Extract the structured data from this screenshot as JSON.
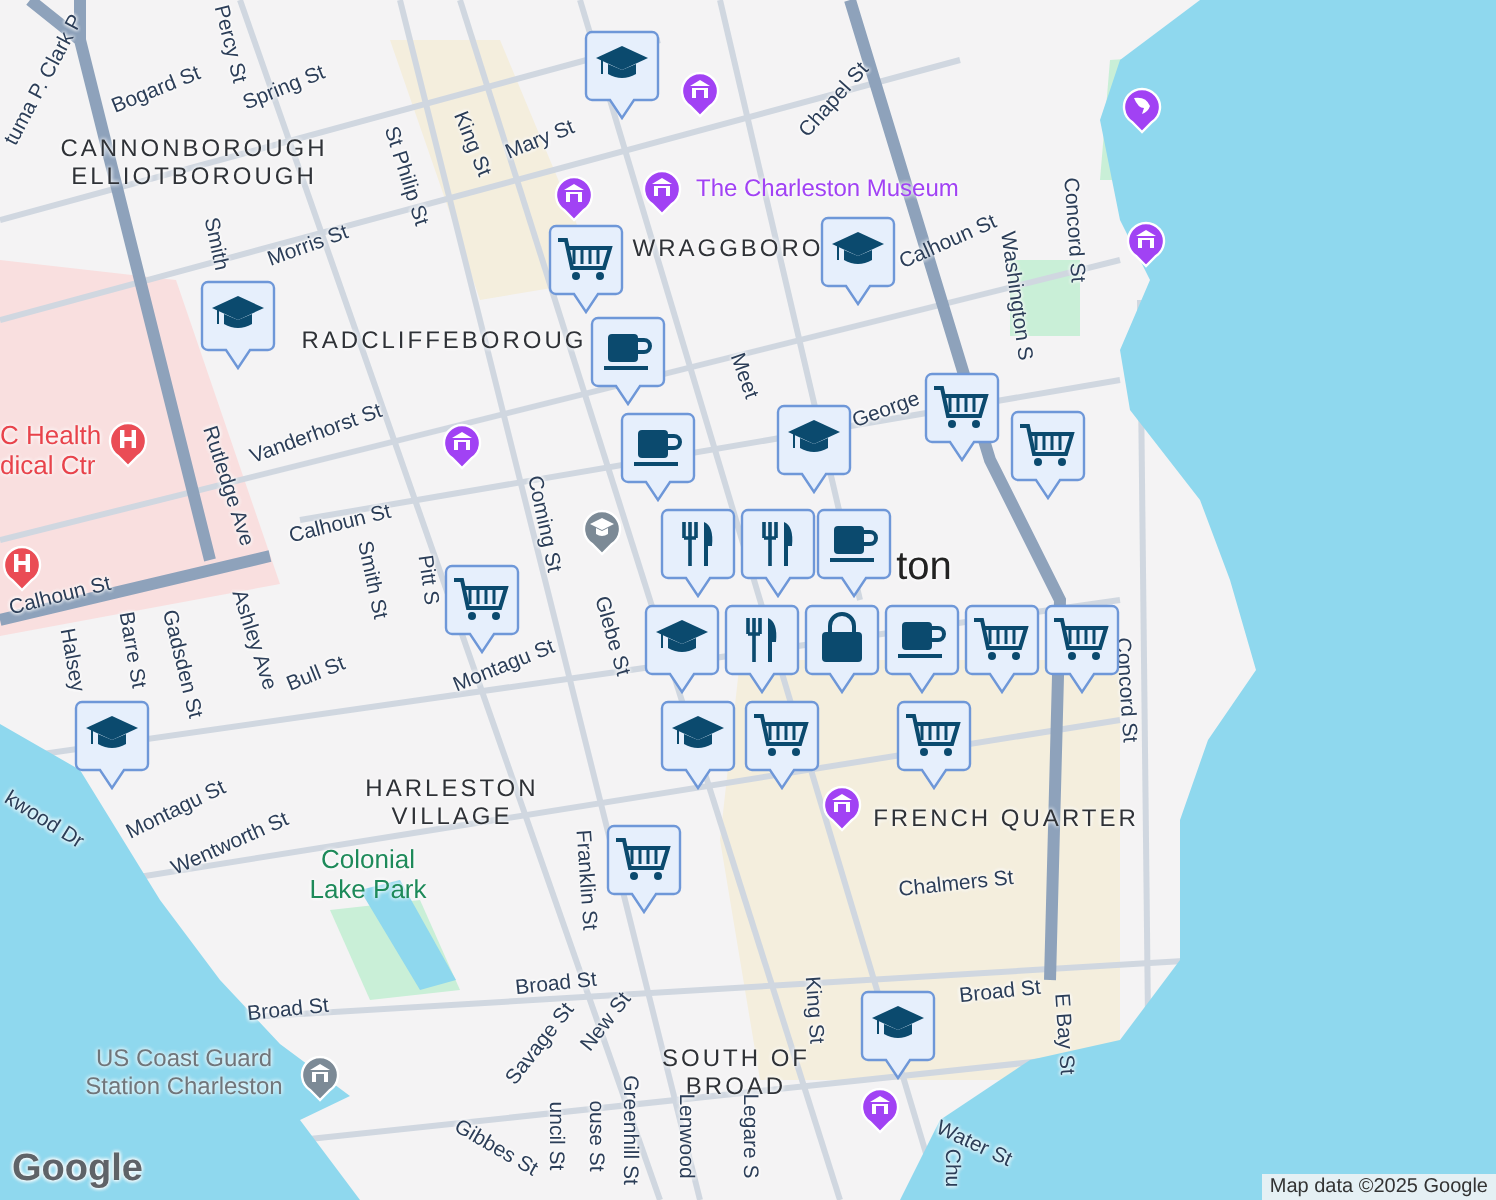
{
  "map": {
    "area_labels": [
      {
        "text": "CANNONBOROUGH\nELLIOTBOROUGH",
        "kind": "neighborhood"
      },
      {
        "text": "RADCLIFFEBOROUG",
        "kind": "neighborhood"
      },
      {
        "text": "WRAGGBORO",
        "kind": "neighborhood"
      },
      {
        "text": "HARLESTON\nVILLAGE",
        "kind": "neighborhood"
      },
      {
        "text": "FRENCH QUARTER",
        "kind": "neighborhood"
      },
      {
        "text": "SOUTH OF\nBROAD",
        "kind": "neighborhood"
      },
      {
        "text": "Colonial\nLake Park",
        "kind": "park"
      },
      {
        "text": "The Charleston Museum",
        "kind": "museum"
      },
      {
        "text": "C Health\ndical Ctr",
        "kind": "hospital"
      },
      {
        "text": "US Coast Guard\nStation Charleston",
        "kind": "civic"
      },
      {
        "text": "ton",
        "kind": "city"
      }
    ],
    "street_labels": [
      "tuma P. Clark P",
      "Bogard St",
      "Percy St",
      "Spring St",
      "St Philip St",
      "King St",
      "Mary St",
      "Chapel St",
      "Smith",
      "Morris St",
      "Calhoun St",
      "Washington S",
      "Concord St",
      "Meet",
      "George",
      "Vanderhorst St",
      "Rutledge Ave",
      "Calhoun St",
      "Smith St",
      "Pitt S",
      "Coming St",
      "Glebe St",
      "Calhoun St",
      "Ashley Ave",
      "Halsey",
      "Barre St",
      "Gadsden St",
      "Bull St",
      "Montagu St",
      "kwood Dr",
      "Montagu St",
      "Wentworth St",
      "Franklin St",
      "Broad St",
      "Broad St",
      "Broad St",
      "Chalmers St",
      "King St",
      "E Bay St",
      "Concord St",
      "Savage St",
      "New St",
      "Gibbes St",
      "uncil St",
      "ouse St",
      "Greenhill St",
      "Lenwood",
      "Legare S",
      "Water St",
      "Chu"
    ],
    "places": [
      {
        "kind": "museum"
      },
      {
        "kind": "museum"
      },
      {
        "kind": "museum"
      },
      {
        "kind": "museum"
      },
      {
        "kind": "aquarium"
      },
      {
        "kind": "museum"
      },
      {
        "kind": "museum"
      },
      {
        "kind": "school"
      },
      {
        "kind": "hospital"
      },
      {
        "kind": "hospital"
      },
      {
        "kind": "civic"
      },
      {
        "kind": "museum"
      }
    ],
    "markers": [
      {
        "kind": "school"
      },
      {
        "kind": "school"
      },
      {
        "kind": "cart"
      },
      {
        "kind": "school"
      },
      {
        "kind": "cafe"
      },
      {
        "kind": "cafe"
      },
      {
        "kind": "school"
      },
      {
        "kind": "cart"
      },
      {
        "kind": "cart"
      },
      {
        "kind": "restaurant"
      },
      {
        "kind": "restaurant"
      },
      {
        "kind": "cafe"
      },
      {
        "kind": "school"
      },
      {
        "kind": "restaurant"
      },
      {
        "kind": "bag"
      },
      {
        "kind": "cafe"
      },
      {
        "kind": "cart"
      },
      {
        "kind": "cart"
      },
      {
        "kind": "school"
      },
      {
        "kind": "cart"
      },
      {
        "kind": "cart"
      },
      {
        "kind": "cart"
      },
      {
        "kind": "school"
      },
      {
        "kind": "cart"
      },
      {
        "kind": "school"
      }
    ],
    "logo": "Google",
    "attribution": "Map data ©2025 Google"
  }
}
